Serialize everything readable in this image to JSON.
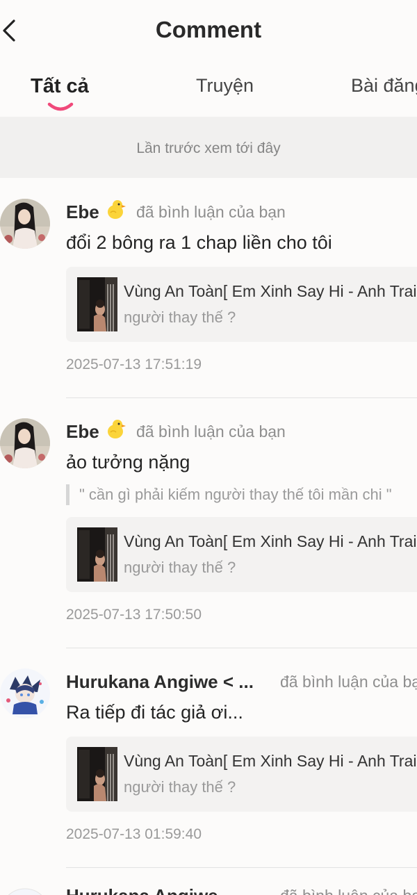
{
  "header": {
    "title": "Comment"
  },
  "tabs": [
    {
      "label": "Tất cả"
    },
    {
      "label": "Truyện"
    },
    {
      "label": "Bài đăng"
    }
  ],
  "banner": {
    "text": "Lần trước xem tới đây"
  },
  "comments": [
    {
      "user": "Ebe",
      "action": "đã bình luận của bạn",
      "text": "đổi 2 bông ra 1 chap liền cho tôi",
      "card_title": "Vùng An Toàn[ Em Xinh Say Hi - Anh Trai",
      "card_subtitle": "người thay thế ?",
      "time": "2025-07-13 17:51:19"
    },
    {
      "user": "Ebe",
      "action": "đã bình luận của bạn",
      "text": "ảo tưởng nặng",
      "quote": "\" cần gì phải kiếm người thay thế tôi mần chi \"",
      "card_title": "Vùng An Toàn[ Em Xinh Say Hi - Anh Trai",
      "card_subtitle": "người thay thế ?",
      "time": "2025-07-13 17:50:50"
    },
    {
      "user": "Hurukana Angiwe < ...",
      "action": "đã bình luận của bạn",
      "text": "Ra tiếp đi tác giả ơi...",
      "card_title": "Vùng An Toàn[ Em Xinh Say Hi - Anh Trai",
      "card_subtitle": "người thay thế ?",
      "time": "2025-07-13 01:59:40"
    },
    {
      "user": "Hurukana Angiwe",
      "action": "đã bình luận của bạn"
    }
  ],
  "colors": {
    "accent": "#f0497a",
    "banner_bg": "#f1f0ef",
    "card_bg": "#f3f2f1"
  }
}
